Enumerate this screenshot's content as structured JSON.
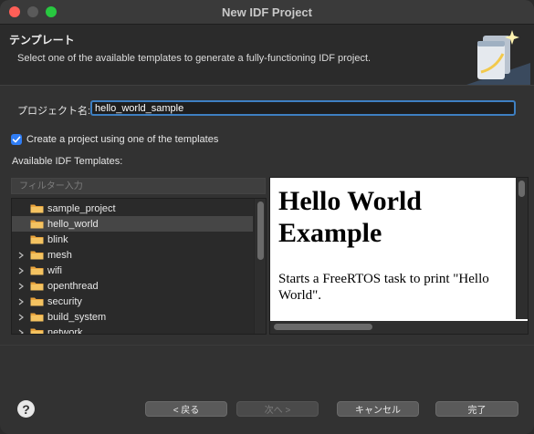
{
  "window": {
    "title": "New IDF Project"
  },
  "header": {
    "title": "テンプレート",
    "description": "Select one of the available templates to generate a fully-functioning IDF project."
  },
  "project_name": {
    "label": "プロジェクト名:",
    "value": "hello_world_sample"
  },
  "use_template": {
    "label": "Create a project using one of the templates",
    "checked": true
  },
  "templates": {
    "label": "Available IDF Templates:",
    "filter_placeholder": "フィルター入力",
    "items": [
      {
        "label": "sample_project",
        "expandable": false,
        "selected": false
      },
      {
        "label": "hello_world",
        "expandable": false,
        "selected": true
      },
      {
        "label": "blink",
        "expandable": false,
        "selected": false
      },
      {
        "label": "mesh",
        "expandable": true,
        "selected": false
      },
      {
        "label": "wifi",
        "expandable": true,
        "selected": false
      },
      {
        "label": "openthread",
        "expandable": true,
        "selected": false
      },
      {
        "label": "security",
        "expandable": true,
        "selected": false
      },
      {
        "label": "build_system",
        "expandable": true,
        "selected": false
      },
      {
        "label": "network",
        "expandable": true,
        "selected": false
      }
    ]
  },
  "preview": {
    "heading": "Hello World Example",
    "body": "Starts a FreeRTOS task to print \"Hello World\"."
  },
  "buttons": {
    "help": "?",
    "back": "< 戻る",
    "next": "次へ >",
    "cancel": "キャンセル",
    "finish": "完了"
  },
  "colors": {
    "accent": "#2f7df5",
    "focus_border": "#3e7fc1"
  }
}
